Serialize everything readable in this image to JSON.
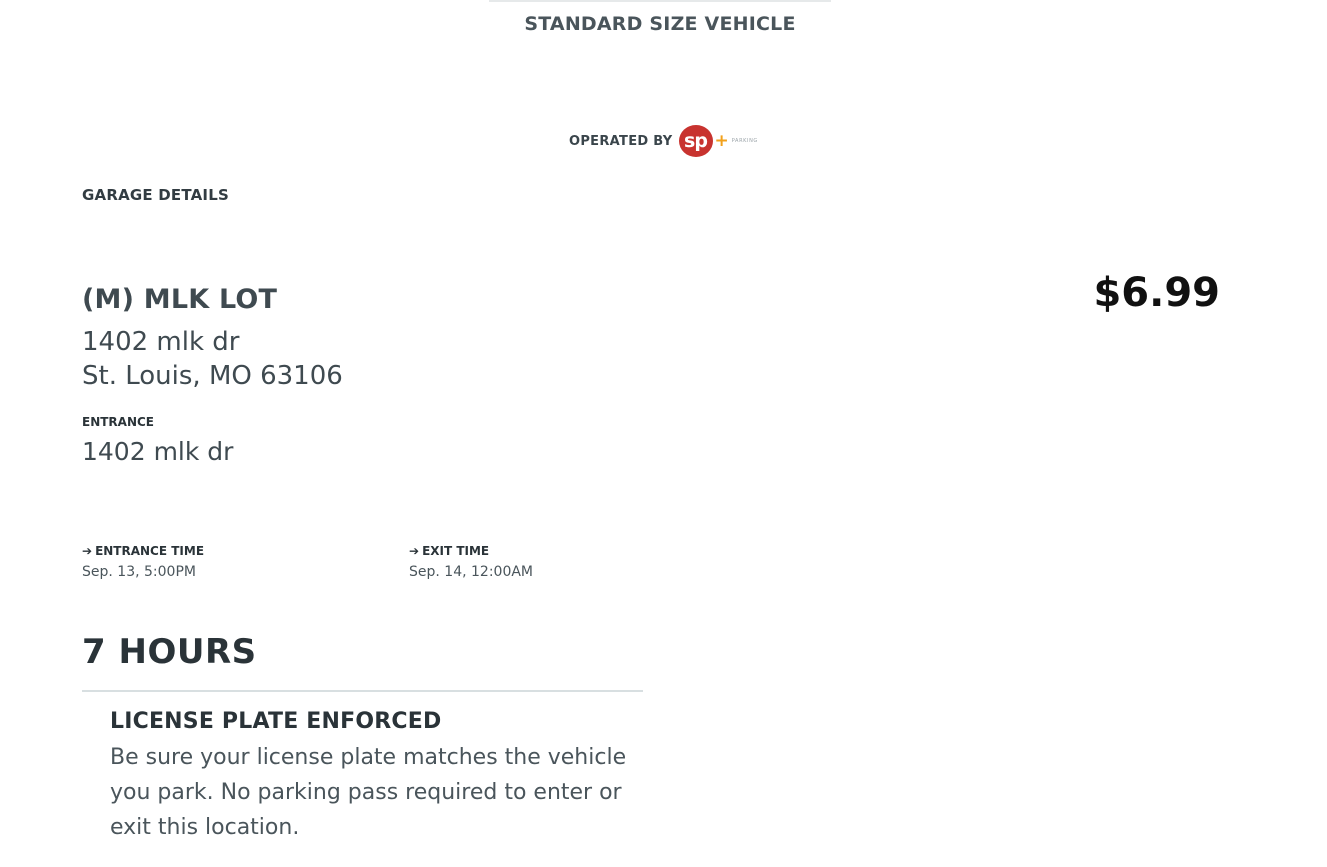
{
  "header": {
    "vehicle_size": "STANDARD SIZE VEHICLE"
  },
  "operator": {
    "label": "OPERATED BY",
    "logo_text": "sp",
    "logo_plus": "+",
    "logo_word": "PARKING",
    "logo_colors": {
      "primary": "#c8332f",
      "accent": "#f2a11b"
    }
  },
  "garage": {
    "section_title": "GARAGE DETAILS",
    "name": "(M) MLK LOT",
    "address_line1": "1402 mlk dr",
    "address_line2": "St. Louis, MO 63106",
    "entrance_label": "ENTRANCE",
    "entrance_value": "1402 mlk dr",
    "price": "$6.99"
  },
  "times": {
    "entrance_label": "ENTRANCE TIME",
    "entrance_value": "Sep. 13, 5:00PM",
    "exit_label": "EXIT TIME",
    "exit_value": "Sep. 14, 12:00AM",
    "icon": "arrow-right-icon"
  },
  "duration": "7 HOURS",
  "notice": {
    "title": "LICENSE PLATE ENFORCED",
    "body": "Be sure your license plate matches the vehicle you park. No parking pass required to enter or exit this location."
  }
}
